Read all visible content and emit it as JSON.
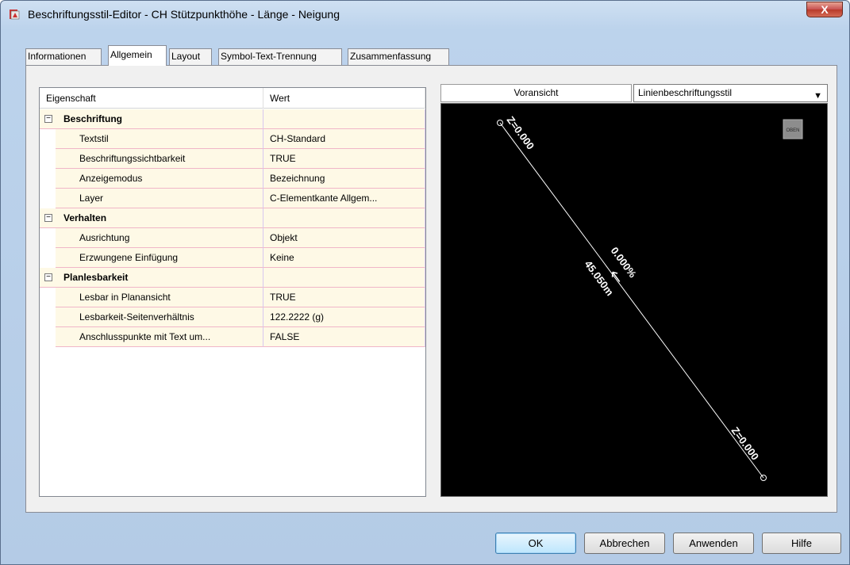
{
  "window": {
    "title": "Beschriftungsstil-Editor - CH Stützpunkthöhe - Länge - Neigung",
    "close_label": "X"
  },
  "tabs": [
    {
      "label": "Informationen"
    },
    {
      "label": "Allgemein"
    },
    {
      "label": "Layout"
    },
    {
      "label": "Symbol-Text-Trennung"
    },
    {
      "label": "Zusammenfassung"
    }
  ],
  "grid": {
    "headers": {
      "property": "Eigenschaft",
      "value": "Wert"
    },
    "groups": [
      {
        "name": "Beschriftung",
        "expander": "−",
        "rows": [
          {
            "property": "Textstil",
            "value": "CH-Standard"
          },
          {
            "property": "Beschriftungssichtbarkeit",
            "value": "TRUE"
          },
          {
            "property": "Anzeigemodus",
            "value": "Bezeichnung"
          },
          {
            "property": "Layer",
            "value": "C-Elementkante Allgem..."
          }
        ]
      },
      {
        "name": "Verhalten",
        "expander": "−",
        "rows": [
          {
            "property": "Ausrichtung",
            "value": "Objekt"
          },
          {
            "property": "Erzwungene Einfügung",
            "value": "Keine"
          }
        ]
      },
      {
        "name": "Planlesbarkeit",
        "expander": "−",
        "rows": [
          {
            "property": "Lesbar in Planansicht",
            "value": "TRUE"
          },
          {
            "property": "Lesbarkeit-Seitenverhältnis",
            "value": "122.2222 (g)"
          },
          {
            "property": "Anschlusspunkte mit Text um...",
            "value": "FALSE"
          }
        ]
      }
    ]
  },
  "preview": {
    "tab_label": "Voransicht",
    "style_select": "Linienbeschriftungsstil",
    "viewcube_label": "OBEN",
    "labels": {
      "start_z": "Z=0.000",
      "end_z": "Z=0.000",
      "slope": "0.000%",
      "length": "45.050m"
    }
  },
  "buttons": {
    "ok": "OK",
    "cancel": "Abbrechen",
    "apply": "Anwenden",
    "help": "Hilfe"
  },
  "colors": {
    "row_bg": "#fef9e6",
    "canvas_bg": "#000000",
    "close_red": "#c75050"
  }
}
